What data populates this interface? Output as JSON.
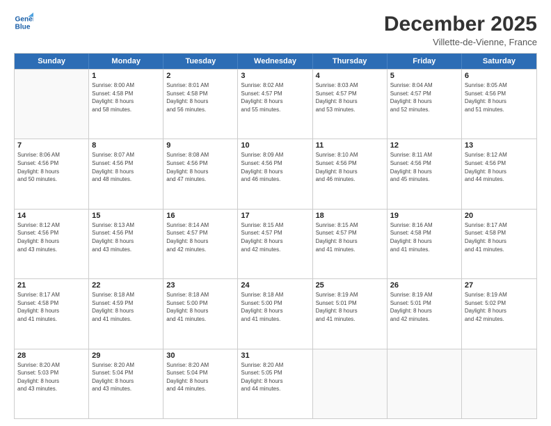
{
  "logo": {
    "line1": "General",
    "line2": "Blue"
  },
  "title": "December 2025",
  "subtitle": "Villette-de-Vienne, France",
  "days_of_week": [
    "Sunday",
    "Monday",
    "Tuesday",
    "Wednesday",
    "Thursday",
    "Friday",
    "Saturday"
  ],
  "weeks": [
    [
      {
        "day": "",
        "info": ""
      },
      {
        "day": "1",
        "info": "Sunrise: 8:00 AM\nSunset: 4:58 PM\nDaylight: 8 hours\nand 58 minutes."
      },
      {
        "day": "2",
        "info": "Sunrise: 8:01 AM\nSunset: 4:58 PM\nDaylight: 8 hours\nand 56 minutes."
      },
      {
        "day": "3",
        "info": "Sunrise: 8:02 AM\nSunset: 4:57 PM\nDaylight: 8 hours\nand 55 minutes."
      },
      {
        "day": "4",
        "info": "Sunrise: 8:03 AM\nSunset: 4:57 PM\nDaylight: 8 hours\nand 53 minutes."
      },
      {
        "day": "5",
        "info": "Sunrise: 8:04 AM\nSunset: 4:57 PM\nDaylight: 8 hours\nand 52 minutes."
      },
      {
        "day": "6",
        "info": "Sunrise: 8:05 AM\nSunset: 4:56 PM\nDaylight: 8 hours\nand 51 minutes."
      }
    ],
    [
      {
        "day": "7",
        "info": "Sunrise: 8:06 AM\nSunset: 4:56 PM\nDaylight: 8 hours\nand 50 minutes."
      },
      {
        "day": "8",
        "info": "Sunrise: 8:07 AM\nSunset: 4:56 PM\nDaylight: 8 hours\nand 48 minutes."
      },
      {
        "day": "9",
        "info": "Sunrise: 8:08 AM\nSunset: 4:56 PM\nDaylight: 8 hours\nand 47 minutes."
      },
      {
        "day": "10",
        "info": "Sunrise: 8:09 AM\nSunset: 4:56 PM\nDaylight: 8 hours\nand 46 minutes."
      },
      {
        "day": "11",
        "info": "Sunrise: 8:10 AM\nSunset: 4:56 PM\nDaylight: 8 hours\nand 46 minutes."
      },
      {
        "day": "12",
        "info": "Sunrise: 8:11 AM\nSunset: 4:56 PM\nDaylight: 8 hours\nand 45 minutes."
      },
      {
        "day": "13",
        "info": "Sunrise: 8:12 AM\nSunset: 4:56 PM\nDaylight: 8 hours\nand 44 minutes."
      }
    ],
    [
      {
        "day": "14",
        "info": "Sunrise: 8:12 AM\nSunset: 4:56 PM\nDaylight: 8 hours\nand 43 minutes."
      },
      {
        "day": "15",
        "info": "Sunrise: 8:13 AM\nSunset: 4:56 PM\nDaylight: 8 hours\nand 43 minutes."
      },
      {
        "day": "16",
        "info": "Sunrise: 8:14 AM\nSunset: 4:57 PM\nDaylight: 8 hours\nand 42 minutes."
      },
      {
        "day": "17",
        "info": "Sunrise: 8:15 AM\nSunset: 4:57 PM\nDaylight: 8 hours\nand 42 minutes."
      },
      {
        "day": "18",
        "info": "Sunrise: 8:15 AM\nSunset: 4:57 PM\nDaylight: 8 hours\nand 41 minutes."
      },
      {
        "day": "19",
        "info": "Sunrise: 8:16 AM\nSunset: 4:58 PM\nDaylight: 8 hours\nand 41 minutes."
      },
      {
        "day": "20",
        "info": "Sunrise: 8:17 AM\nSunset: 4:58 PM\nDaylight: 8 hours\nand 41 minutes."
      }
    ],
    [
      {
        "day": "21",
        "info": "Sunrise: 8:17 AM\nSunset: 4:58 PM\nDaylight: 8 hours\nand 41 minutes."
      },
      {
        "day": "22",
        "info": "Sunrise: 8:18 AM\nSunset: 4:59 PM\nDaylight: 8 hours\nand 41 minutes."
      },
      {
        "day": "23",
        "info": "Sunrise: 8:18 AM\nSunset: 5:00 PM\nDaylight: 8 hours\nand 41 minutes."
      },
      {
        "day": "24",
        "info": "Sunrise: 8:18 AM\nSunset: 5:00 PM\nDaylight: 8 hours\nand 41 minutes."
      },
      {
        "day": "25",
        "info": "Sunrise: 8:19 AM\nSunset: 5:01 PM\nDaylight: 8 hours\nand 41 minutes."
      },
      {
        "day": "26",
        "info": "Sunrise: 8:19 AM\nSunset: 5:01 PM\nDaylight: 8 hours\nand 42 minutes."
      },
      {
        "day": "27",
        "info": "Sunrise: 8:19 AM\nSunset: 5:02 PM\nDaylight: 8 hours\nand 42 minutes."
      }
    ],
    [
      {
        "day": "28",
        "info": "Sunrise: 8:20 AM\nSunset: 5:03 PM\nDaylight: 8 hours\nand 43 minutes."
      },
      {
        "day": "29",
        "info": "Sunrise: 8:20 AM\nSunset: 5:04 PM\nDaylight: 8 hours\nand 43 minutes."
      },
      {
        "day": "30",
        "info": "Sunrise: 8:20 AM\nSunset: 5:04 PM\nDaylight: 8 hours\nand 44 minutes."
      },
      {
        "day": "31",
        "info": "Sunrise: 8:20 AM\nSunset: 5:05 PM\nDaylight: 8 hours\nand 44 minutes."
      },
      {
        "day": "",
        "info": ""
      },
      {
        "day": "",
        "info": ""
      },
      {
        "day": "",
        "info": ""
      }
    ]
  ]
}
